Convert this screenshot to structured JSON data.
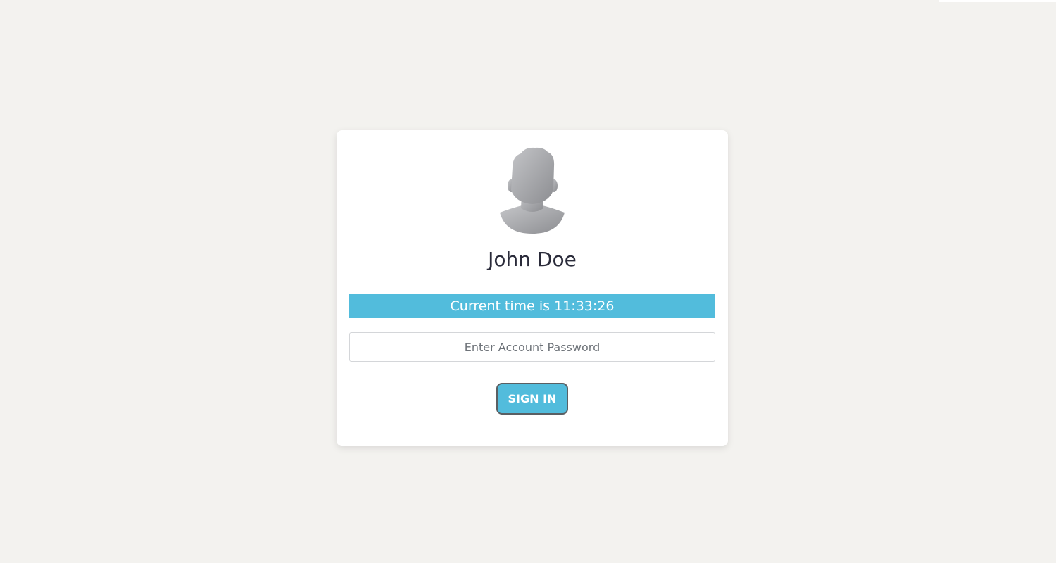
{
  "user": {
    "name": "John Doe",
    "avatar_icon": "user-silhouette-icon"
  },
  "clock": {
    "text": "Current time is 11:33:26"
  },
  "password": {
    "placeholder": "Enter Account Password",
    "value": ""
  },
  "actions": {
    "sign_in_label": "SIGN IN"
  },
  "colors": {
    "background": "#f3f2ef",
    "accent": "#52bcdc",
    "card": "#ffffff",
    "button_border": "#5a5f63",
    "text": "#2a2b3a"
  }
}
